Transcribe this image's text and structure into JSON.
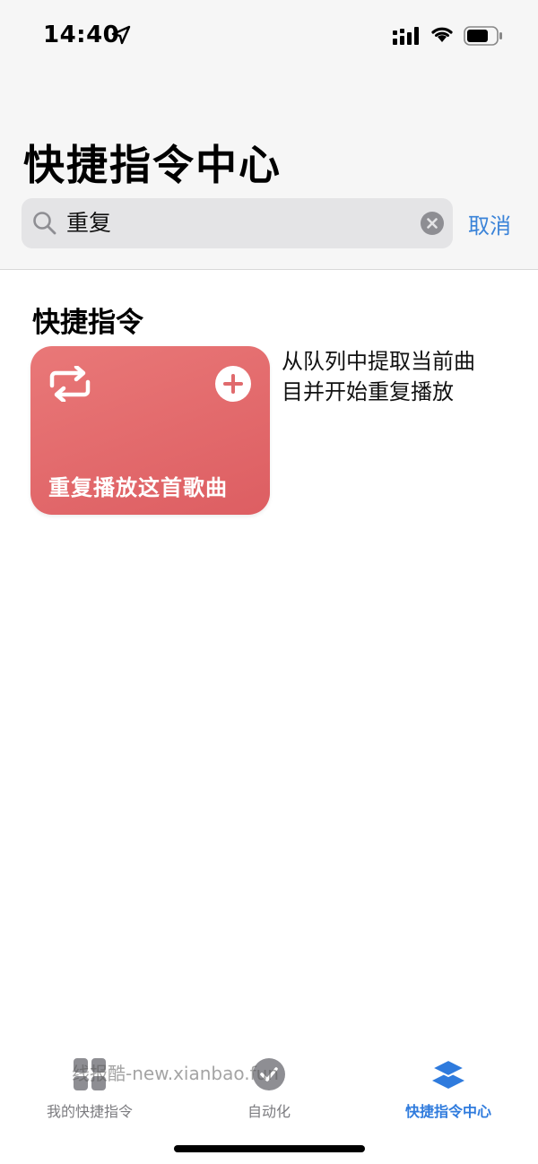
{
  "status_bar": {
    "time": "14:40"
  },
  "header": {
    "title": "快捷指令中心"
  },
  "search": {
    "value": "重复",
    "cancel_label": "取消"
  },
  "section": {
    "title": "快捷指令"
  },
  "shortcut": {
    "title": "重复播放这首歌曲",
    "description": "从队列中提取当前曲目并开始重复播放",
    "color": "#e06a6d",
    "icon": "repeat-icon"
  },
  "tabs": [
    {
      "label": "我的快捷指令",
      "icon": "grid-icon"
    },
    {
      "label": "自动化",
      "icon": "automation-check-icon"
    },
    {
      "label": "快捷指令中心",
      "icon": "layers-icon",
      "active": true
    }
  ],
  "watermark": {
    "text": "线报酷-new.xianbao.fun"
  },
  "colors": {
    "accent": "#3a83d8",
    "tab_active": "#2f7bdd"
  }
}
